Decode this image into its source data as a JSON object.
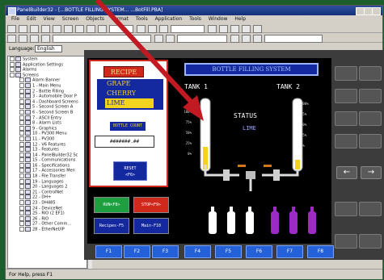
{
  "window": {
    "title": "PanelBuilder32 - [...BOTTLE FILLING SYSTEM... ...BotFill.PBA]",
    "menus": [
      "File",
      "Edit",
      "View",
      "Screen",
      "Objects",
      "Format",
      "Tools",
      "Application",
      "Tools",
      "Window",
      "Help"
    ]
  },
  "language": {
    "label": "Language:",
    "value": "English"
  },
  "tree": [
    {
      "label": "System",
      "indent": 0
    },
    {
      "label": "Application Settings",
      "indent": 0
    },
    {
      "label": "Alarms",
      "indent": 0
    },
    {
      "label": "Screens",
      "indent": 0
    },
    {
      "label": "Alarm Banner",
      "indent": 1
    },
    {
      "label": "1 - Main Menu",
      "indent": 1
    },
    {
      "label": "2 - Bottle Filling",
      "indent": 1
    },
    {
      "label": "3 - Automobile Door P",
      "indent": 1
    },
    {
      "label": "4 - Dashboard Screens",
      "indent": 1
    },
    {
      "label": "5 - Second Screen A",
      "indent": 1
    },
    {
      "label": "6 - Second Screen B",
      "indent": 1
    },
    {
      "label": "7 - ASCII Entry",
      "indent": 1
    },
    {
      "label": "8 - Alarm Lists",
      "indent": 1
    },
    {
      "label": "9 - Graphics",
      "indent": 1
    },
    {
      "label": "10 - PV300 Menu",
      "indent": 1
    },
    {
      "label": "11 - PV300",
      "indent": 1
    },
    {
      "label": "12 - V6 Features",
      "indent": 1
    },
    {
      "label": "13 - Features",
      "indent": 1
    },
    {
      "label": "14 - PanelBuilder32 Sc",
      "indent": 1
    },
    {
      "label": "15 - Communications",
      "indent": 1
    },
    {
      "label": "16 - Specifications",
      "indent": 1
    },
    {
      "label": "17 - Accessories Men",
      "indent": 1
    },
    {
      "label": "18 - File Transfer",
      "indent": 1
    },
    {
      "label": "19 - Languages",
      "indent": 1
    },
    {
      "label": "20 - Languages 2",
      "indent": 1
    },
    {
      "label": "21 - ControlNet",
      "indent": 1
    },
    {
      "label": "22 - DH+",
      "indent": 1
    },
    {
      "label": "23 - DH485",
      "indent": 1
    },
    {
      "label": "24 - DeviceNet",
      "indent": 1
    },
    {
      "label": "25 - RIO (2 EF1)",
      "indent": 1
    },
    {
      "label": "26 - RIO",
      "indent": 1
    },
    {
      "label": "27 - Other Comm...",
      "indent": 1
    },
    {
      "label": "28 - EtherNet/IP",
      "indent": 1
    }
  ],
  "status_bar": {
    "text": "For Help, press F1"
  },
  "hmi": {
    "recipe_header": "RECIPE",
    "recipes": [
      "GRAPE",
      "CHERRY",
      "LIME"
    ],
    "selected_recipe_index": 2,
    "bottle_count_label": "BOTTLE COUNT",
    "bottle_count_value": "#######.##",
    "reset_label_line1": "RESET",
    "reset_label_line2": "<F6>",
    "run_label": "RUN<F8>",
    "stop_label": "STOP<F9>",
    "recipes_key_label": "Recipes-F5",
    "main_key_label": "Main-F10",
    "system_title": "BOTTLE FILLING SYSTEM",
    "tank1_label": "TANK 1",
    "tank2_label": "TANK 2",
    "scale_ticks": [
      "100%",
      "75%",
      "50%",
      "25%",
      "0%"
    ],
    "status_label": "STATUS",
    "status_value": "LIME",
    "colors": {
      "red": "#d0281a",
      "blue": "#1428a0",
      "yellow": "#f4d31f",
      "green": "#1ea040",
      "purple": "#9b2bc4"
    }
  },
  "function_keys": [
    "F1",
    "F2",
    "F3",
    "F4",
    "F5",
    "F6",
    "F7",
    "F8"
  ],
  "side_keys": [
    "←",
    "→"
  ]
}
